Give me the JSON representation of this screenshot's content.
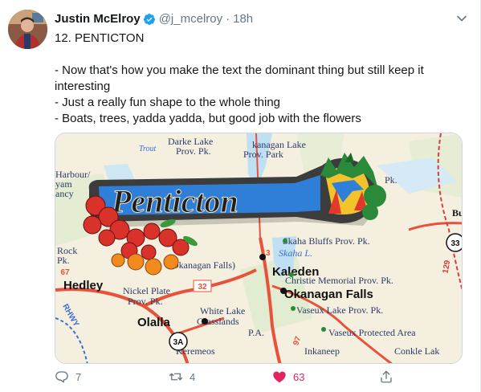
{
  "tweet": {
    "author": {
      "display_name": "Justin McElroy",
      "handle": "@j_mcelroy",
      "separator": "·",
      "time": "18h",
      "verified_icon": "verified-badge-icon"
    },
    "text_lines": [
      "12. PENTICTON",
      "",
      "- Now that's how you make the text the dominant thing but still keep it interesting",
      "- Just a really fun shape to the whole thing",
      "- Boats, trees, yadda yadda, but good job with the flowers"
    ],
    "media": {
      "pin_text": "Penticton",
      "map_labels": {
        "darke_lake": "Darke Lake",
        "darke_prov": "Prov. Pk.",
        "okanagan_lake": "kanagan Lake",
        "prov_park": "Prov. Park",
        "trout": "Trout",
        "harbour": "Harbour/",
        "yam": "yam",
        "ancy": "ancy",
        "pk_right": "Pk.",
        "rock": "Rock",
        "pk_left": "Pk.",
        "hedley": "Hedley",
        "skaha_bluffs": "Skaha Bluffs Prov. Pk.",
        "skaha_lake": "Skaha L.",
        "okanagan_falls_small": "Okanagan Falls)",
        "kaleden": "Kaleden",
        "christie": "Christie Memorial Prov. Pk.",
        "okanagan_falls": "Okanagan Falls",
        "nickel_plate": "Nickel Plate",
        "nickel_prov": "Prov. Pk.",
        "white_lake": "White Lake",
        "grasslands": "Grasslands",
        "pa": "P.A.",
        "vaseux_lake": "Vaseux Lake Prov. Pk.",
        "olalla": "Olalla",
        "vaseux_protected": "Vaseux Protected Area",
        "keremeos": "Keremeos",
        "inkaneep": "Inkaneep",
        "conkle": "Conkle Lak",
        "hwy_3a": "3A",
        "hwy_32": "32",
        "hwy_33": "33",
        "hwy_97": "97",
        "hwy_129": "129",
        "hwy_67": "67",
        "hwy_13": "13",
        "rhwy": "RHWY",
        "b_label": "Bu"
      }
    },
    "actions": {
      "reply_icon": "reply-icon",
      "reply_count": "7",
      "retweet_icon": "retweet-icon",
      "retweet_count": "4",
      "like_icon": "heart-icon",
      "like_count": "63",
      "share_icon": "share-icon"
    },
    "colors": {
      "text_primary": "#14171a",
      "text_secondary": "#657786",
      "like_active": "#e0245e",
      "verified": "#1da1f2"
    }
  }
}
